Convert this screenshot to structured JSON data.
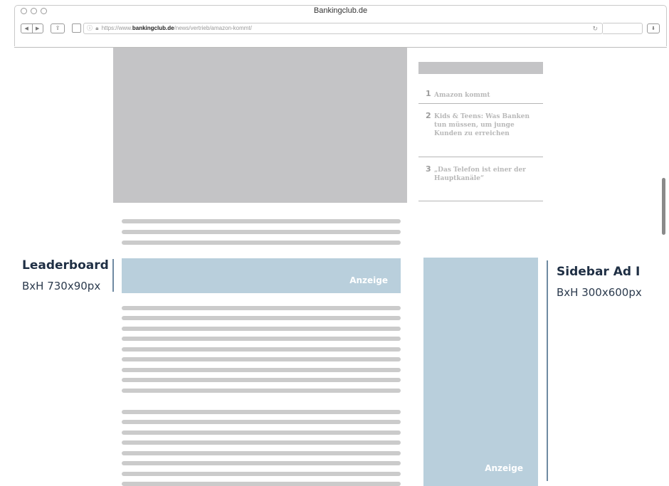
{
  "browser": {
    "window_title": "Bankingclub.de",
    "url_prefix": "https://www.",
    "url_domain": "bankingclub.de",
    "url_path": "/news/vertrieb/amazon-kommt/",
    "icons": [
      "back-icon",
      "forward-icon",
      "share-icon",
      "sidebar-icon",
      "info-icon",
      "lock-icon",
      "reload-icon",
      "download-icon"
    ]
  },
  "top_list": {
    "items": [
      {
        "number": "1",
        "title": "Amazon kommt"
      },
      {
        "number": "2",
        "title": "Kids & Teens: Was Banken tun müssen, um junge Kunden zu erreichen"
      },
      {
        "number": "3",
        "title": "„Das Telefon ist einer der Hauptkanäle“"
      }
    ]
  },
  "leaderboard": {
    "title": "Leaderboard",
    "size": "BxH 730x90px",
    "ad_label": "Anzeige"
  },
  "sidebar_ad": {
    "title": "Sidebar Ad I",
    "size": "BxH 300x600px",
    "ad_label": "Anzeige"
  },
  "colors": {
    "placeholder_gray": "#c4c4c6",
    "ad_blue": "#b9cfdc",
    "annotation_navy": "#1f2f44"
  }
}
